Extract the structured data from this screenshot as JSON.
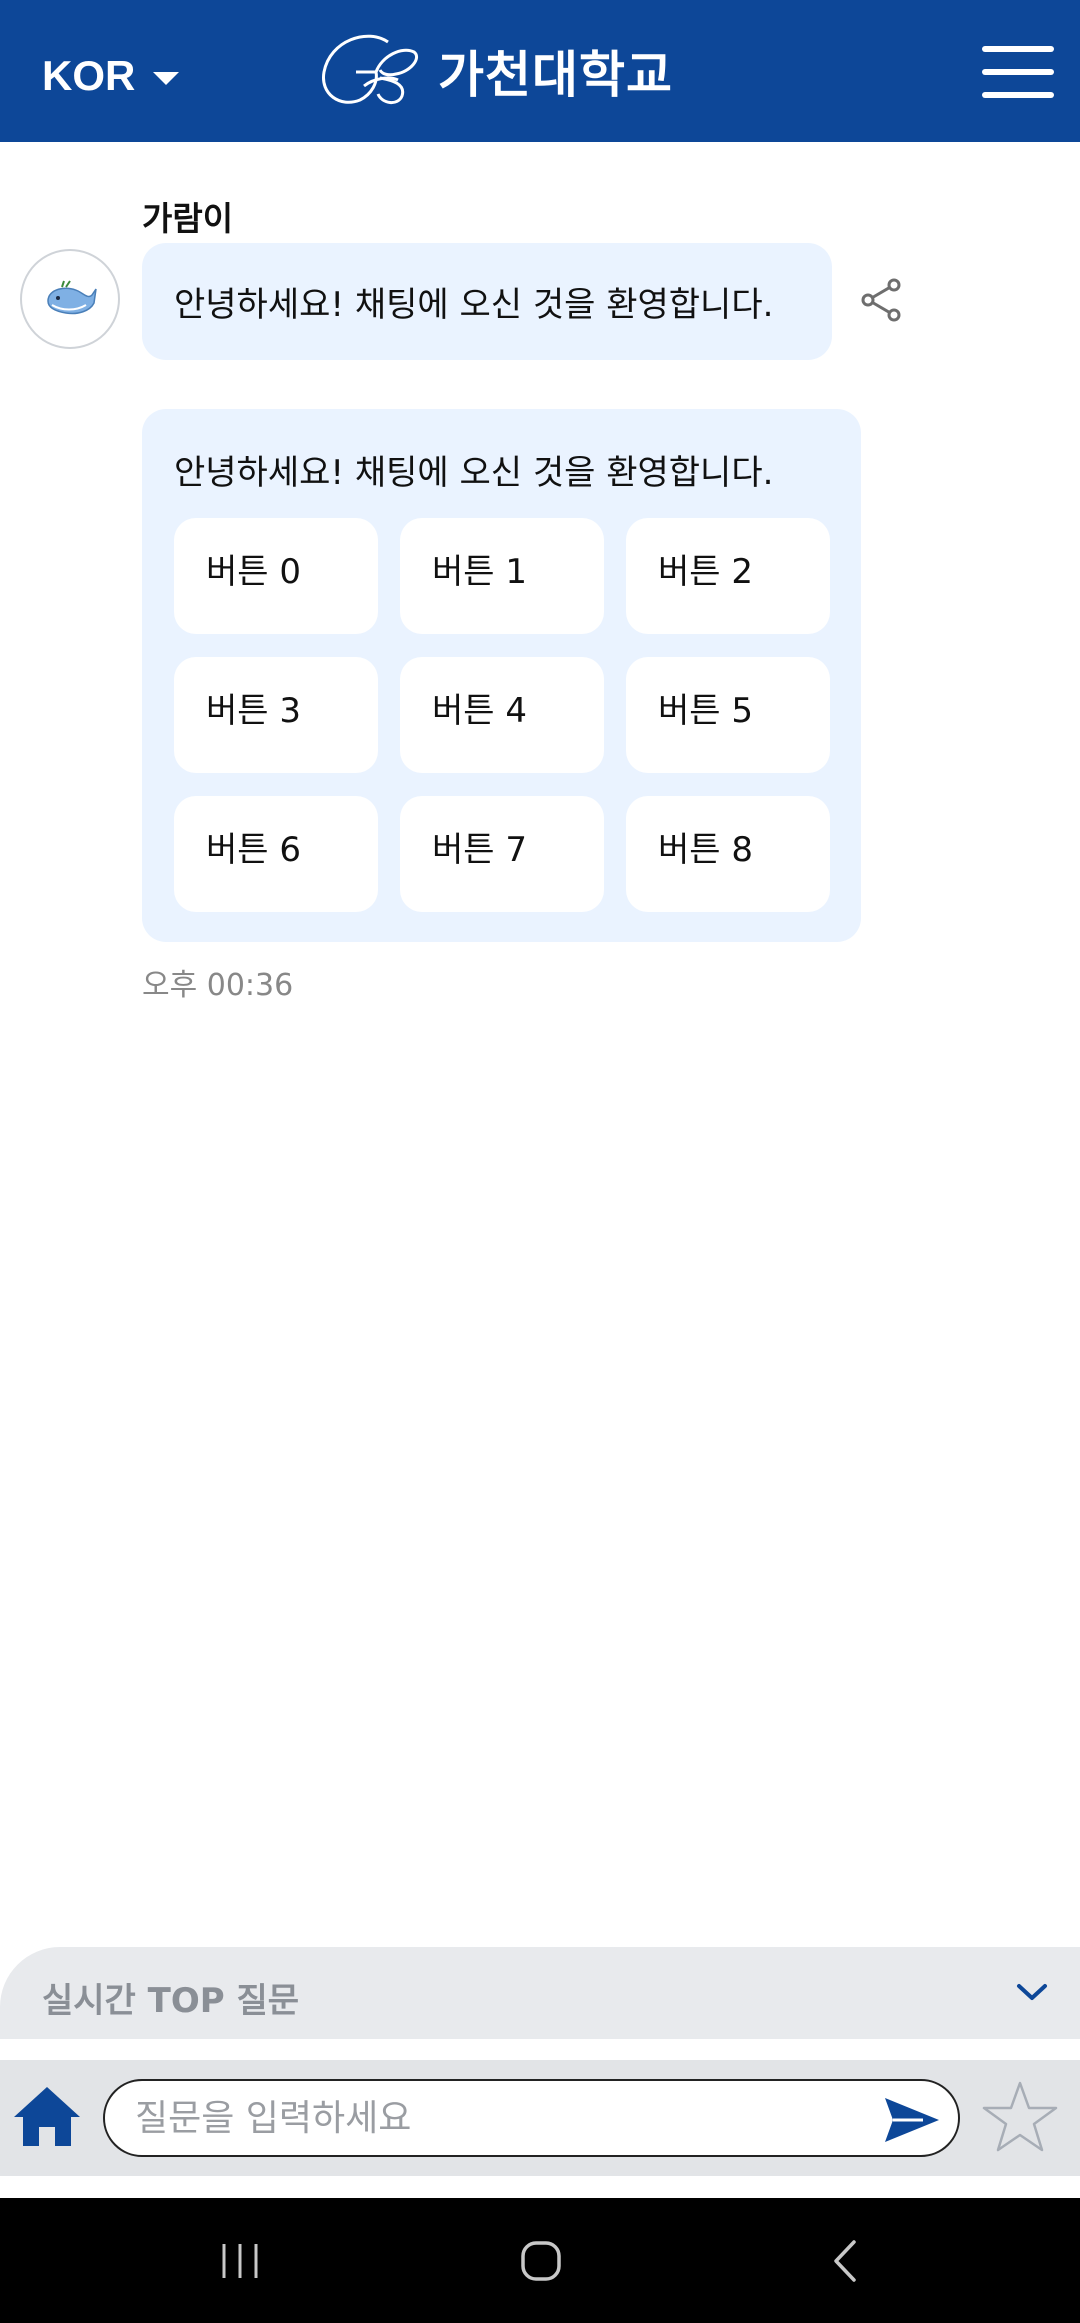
{
  "header": {
    "language": "KOR",
    "brand_name": "가천대학교",
    "bg_color": "#0d4798"
  },
  "chat": {
    "sender_name": "가람이",
    "greeting_message": "안녕하세요! 채팅에 오신 것을 환영합니다.",
    "card_message": "안녕하세요! 채팅에 오신 것을 환영합니다.",
    "buttons": [
      {
        "label": "버튼 0"
      },
      {
        "label": "버튼 1"
      },
      {
        "label": "버튼 2"
      },
      {
        "label": "버튼 3"
      },
      {
        "label": "버튼 4"
      },
      {
        "label": "버튼 5"
      },
      {
        "label": "버튼 6"
      },
      {
        "label": "버튼 7"
      },
      {
        "label": "버튼 8"
      }
    ],
    "timestamp": "오후 00:36",
    "bubble_color": "#eaf3ff"
  },
  "top_questions": {
    "label": "실시간 TOP 질문"
  },
  "input": {
    "placeholder": "질문을 입력하세요",
    "value": ""
  },
  "icons": {
    "menu": "hamburger-menu-icon",
    "share": "share-icon",
    "expand": "chevron-down-icon",
    "home": "home-icon",
    "send": "send-icon",
    "favorite": "star-icon"
  }
}
